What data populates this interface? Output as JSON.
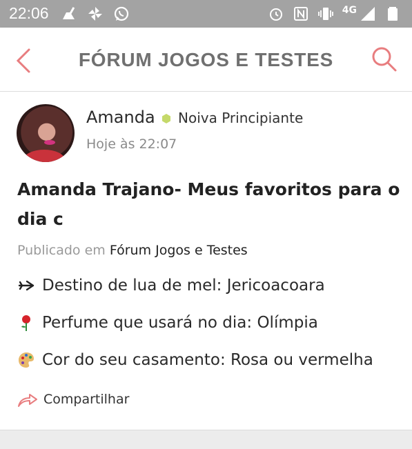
{
  "status_bar": {
    "time": "22:06",
    "network": "4G",
    "left_icons": [
      "cleaner-icon",
      "pinwheel-icon",
      "whatsapp-icon"
    ],
    "right_icons": [
      "alarm-icon",
      "nfc-icon",
      "vibrate-icon",
      "signal-icon",
      "battery-icon"
    ]
  },
  "app_bar": {
    "title": "FÓRUM JOGOS E TESTES",
    "accent_color": "#e87d7f"
  },
  "post": {
    "author": "Amanda",
    "rank": "Noiva Principiante",
    "rank_color": "#c5d96a",
    "time": "Hoje às 22:07",
    "title": "Amanda Trajano- Meus favoritos para o dia c",
    "published_prefix": "Publicado em",
    "published_forum": "Fórum Jogos e Testes",
    "lines": [
      {
        "icon": "airplane-icon",
        "text": "Destino de lua de mel: Jericoacoara"
      },
      {
        "icon": "rose-icon",
        "text": "Perfume que usará no dia: Olímpia"
      },
      {
        "icon": "palette-icon",
        "text": "Cor do seu casamento: Rosa ou vermelha"
      }
    ],
    "share_label": "Compartilhar"
  }
}
